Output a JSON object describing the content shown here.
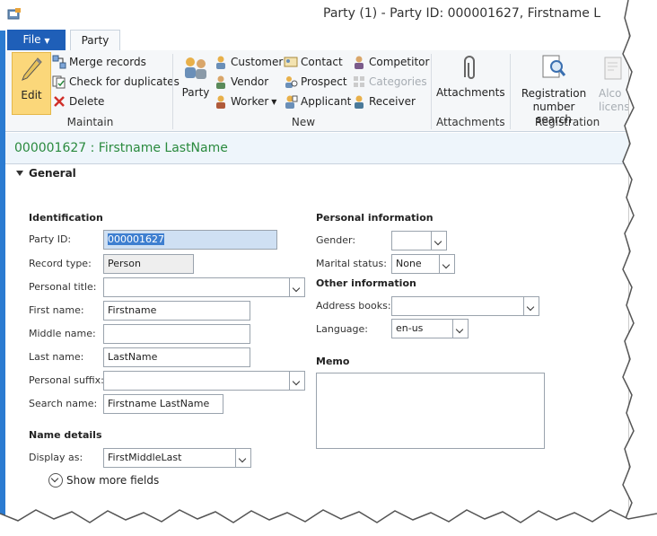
{
  "window": {
    "title": "Party (1) - Party ID: 000001627, Firstname L"
  },
  "tabs": {
    "file": "File",
    "party": "Party"
  },
  "ribbon": {
    "maintain": {
      "edit": "Edit",
      "merge": "Merge records",
      "check": "Check for duplicates",
      "delete": "Delete",
      "label": "Maintain"
    },
    "new": {
      "party": "Party",
      "customer": "Customer",
      "vendor": "Vendor",
      "worker": "Worker",
      "contact": "Contact",
      "prospect": "Prospect",
      "applicant": "Applicant",
      "competitor": "Competitor",
      "categories": "Categories",
      "receiver": "Receiver",
      "label": "New"
    },
    "attachments": {
      "button": "Attachments",
      "label": "Attachments"
    },
    "registration": {
      "button_line1": "Registration",
      "button_line2": "number search",
      "cut_line1": "Alco",
      "cut_line2": "licens",
      "label": "Registration"
    }
  },
  "record": {
    "title": "000001627 : Firstname LastName"
  },
  "general": {
    "header": "General",
    "identification": {
      "header": "Identification",
      "party_id_label": "Party ID:",
      "party_id": "000001627",
      "record_type_label": "Record type:",
      "record_type": "Person",
      "personal_title_label": "Personal title:",
      "personal_title": "",
      "first_name_label": "First name:",
      "first_name": "Firstname",
      "middle_name_label": "Middle name:",
      "middle_name": "",
      "last_name_label": "Last name:",
      "last_name": "LastName",
      "personal_suffix_label": "Personal suffix:",
      "personal_suffix": "",
      "search_name_label": "Search name:",
      "search_name": "Firstname LastName"
    },
    "name_details": {
      "header": "Name details",
      "display_as_label": "Display as:",
      "display_as": "FirstMiddleLast"
    },
    "personal_information": {
      "header": "Personal information",
      "gender_label": "Gender:",
      "gender": "",
      "marital_label": "Marital status:",
      "marital": "None"
    },
    "other_information": {
      "header": "Other information",
      "address_books_label": "Address books:",
      "address_books": "",
      "language_label": "Language:",
      "language": "en-us"
    },
    "memo": {
      "header": "Memo",
      "value": ""
    },
    "show_more": "Show more fields"
  },
  "colors": {
    "accent": "#1f5fb8",
    "record_title": "#2a8a3e",
    "edit_highlight": "#fbd77a"
  }
}
